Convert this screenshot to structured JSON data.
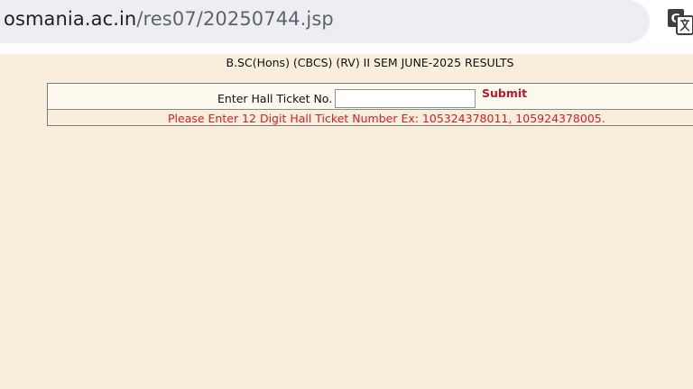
{
  "browser": {
    "url_lead": "s",
    "url_domain": "osmania.ac.in",
    "url_path": "/res07/20250744.jsp",
    "translate_icon": "translate-icon"
  },
  "page": {
    "title": "B.SC(Hons) (CBCS) (RV) II SEM JUNE-2025 RESULTS",
    "form": {
      "label": "Enter Hall Ticket No. :",
      "input_value": "",
      "input_placeholder": "",
      "submit_label": "Submit",
      "hint": "Please Enter 12 Digit Hall Ticket Number Ex: 105324378011, 105924378005."
    }
  },
  "colors": {
    "page_background": "#f8eedb",
    "submit": "#c0182a",
    "hint": "#d41e2e"
  }
}
